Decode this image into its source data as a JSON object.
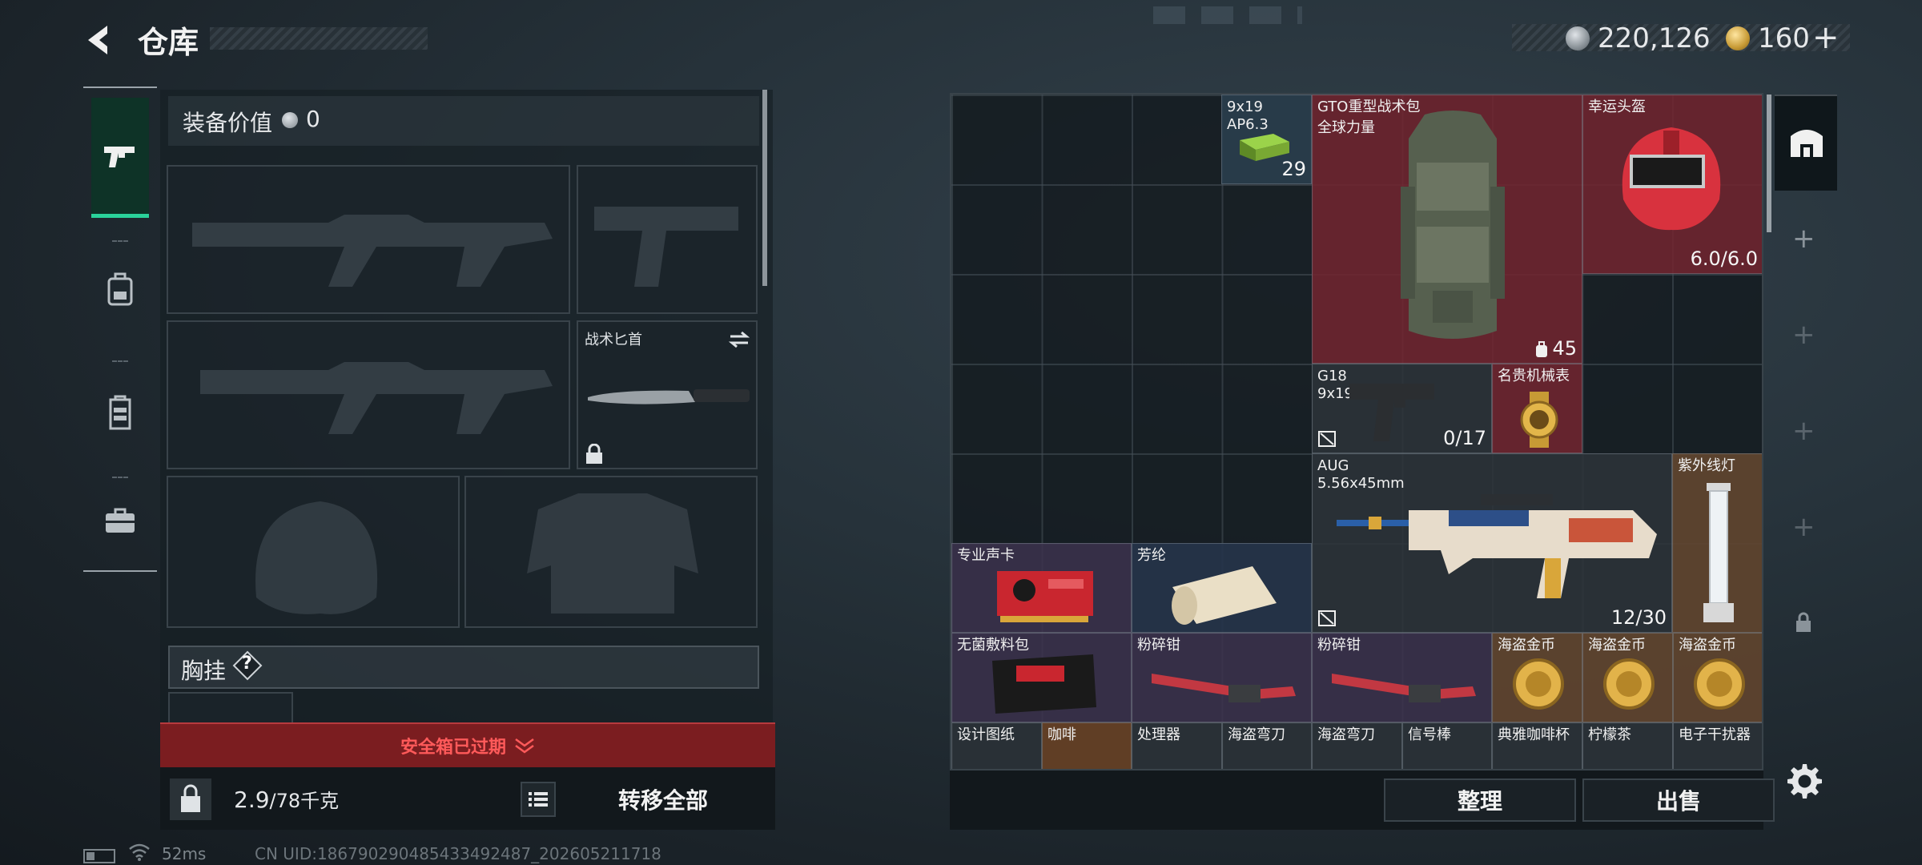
{
  "header": {
    "title": "仓库",
    "currency1": "220,126",
    "currency2": "160",
    "plus": "+"
  },
  "left_tabs": [
    {
      "icon": "pistol-icon",
      "active": true
    },
    {
      "icon": "backpack-icon",
      "active": false
    },
    {
      "icon": "chest-rig-icon",
      "active": false
    },
    {
      "icon": "toolbox-icon",
      "active": false
    }
  ],
  "equipment": {
    "value_label": "装备价值",
    "value": "0",
    "knife_label": "战术匕首",
    "chest_label": "胸挂",
    "chest_help": "?",
    "safe_box": "安全箱已过期",
    "weight": "2.9",
    "weight_max": "/78千克",
    "transfer_all": "转移全部"
  },
  "stash": {
    "items": [
      {
        "name": "9x19",
        "sub": "AP6.3",
        "count": "29"
      },
      {
        "name": "GTO重型战术包",
        "sub": "全球力量",
        "count": "45"
      },
      {
        "name": "幸运头盔",
        "count": "6.0/6.0"
      },
      {
        "name": "G18",
        "sub": "9x19mm",
        "count": "0/17"
      },
      {
        "name": "名贵机械表"
      },
      {
        "name": "AUG",
        "sub": "5.56x45mm",
        "count": "12/30"
      },
      {
        "name": "紫外线灯"
      },
      {
        "name": "专业声卡"
      },
      {
        "name": "芳纶"
      },
      {
        "name": "无菌敷料包"
      },
      {
        "name": "粉碎钳"
      },
      {
        "name": "粉碎钳"
      },
      {
        "name": "海盗金币"
      },
      {
        "name": "海盗金币"
      },
      {
        "name": "海盗金币"
      },
      {
        "name": "设计图纸"
      },
      {
        "name": "咖啡"
      },
      {
        "name": "处理器"
      },
      {
        "name": "海盗弯刀"
      },
      {
        "name": "海盗弯刀"
      },
      {
        "name": "信号棒"
      },
      {
        "name": "典雅咖啡杯"
      },
      {
        "name": "柠檬茶"
      },
      {
        "name": "电子干扰器"
      }
    ]
  },
  "buttons": {
    "sort": "整理",
    "sell": "出售"
  },
  "status": {
    "ping": "52ms",
    "uid": "CN UID:18679029048543349248​7_202605211718"
  },
  "colors": {
    "accent_green": "#2ad39a",
    "rarity_red": "#73262f",
    "rarity_gold": "#684226",
    "rarity_purple": "#3c324e",
    "rarity_blue": "#26344a",
    "safe_box_red": "#ff5a5a"
  }
}
